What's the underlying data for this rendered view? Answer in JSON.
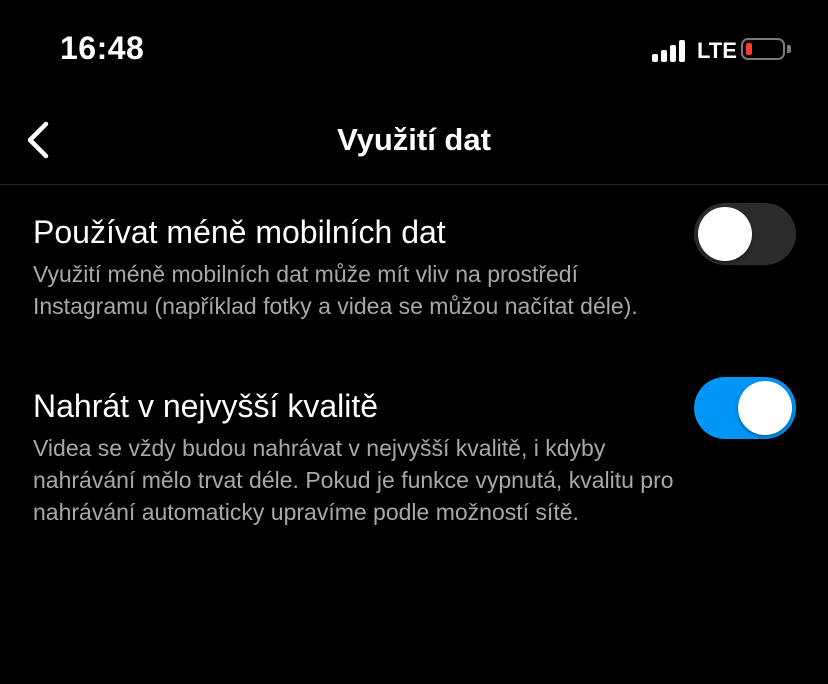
{
  "status_bar": {
    "time": "16:48",
    "network": "LTE",
    "battery_color": "#ff3b30"
  },
  "nav": {
    "title": "Využití dat",
    "back_icon": "chevron-left-icon"
  },
  "settings": [
    {
      "title": "Používat méně mobilních dat",
      "description": "Využití méně mobilních dat může mít vliv na prostředí Instagramu (například fotky a videa se můžou načítat déle).",
      "enabled": false
    },
    {
      "title": "Nahrát v nejvyšší kvalitě",
      "description": "Videa se vždy budou nahrávat v nejvyšší kvalitě, i kdyby nahrávání mělo trvat déle. Pokud je funkce vypnutá, kvalitu pro nahrávání automaticky upravíme podle možností sítě.",
      "enabled": true
    }
  ],
  "colors": {
    "toggle_on": "#0095f6",
    "toggle_off": "#2c2c2e"
  }
}
